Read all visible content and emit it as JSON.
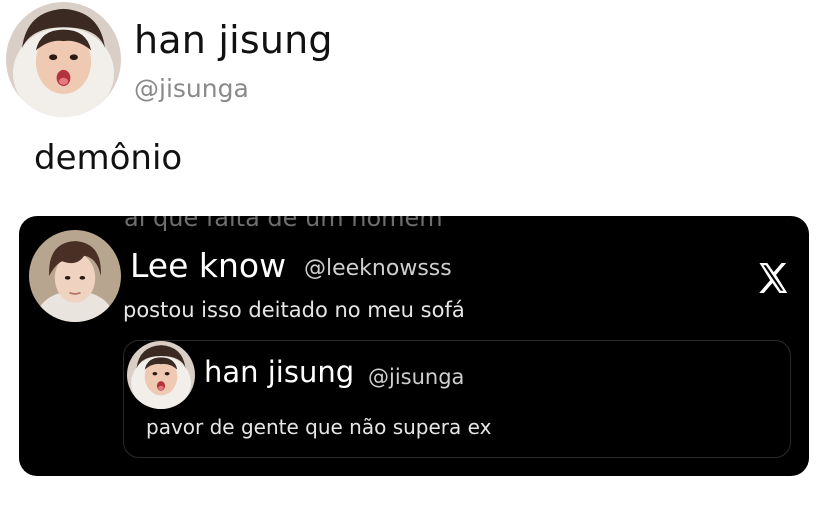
{
  "tweet": {
    "author_name": "han jisung",
    "author_handle": "@jisunga",
    "text": "demônio",
    "avatar_icon": "avatar-photo-icon"
  },
  "embedded": {
    "ghost_text": "aí que falta de um homem",
    "author_name": "Lee know",
    "author_handle": "@leeknowsss",
    "text": "postou isso deitado no meu sofá",
    "logo_icon": "x-logo-icon",
    "background_color": "#000000",
    "quote": {
      "author_name": "han jisung",
      "author_handle": "@jisunga",
      "text": "pavor de gente que não supera ex"
    }
  }
}
